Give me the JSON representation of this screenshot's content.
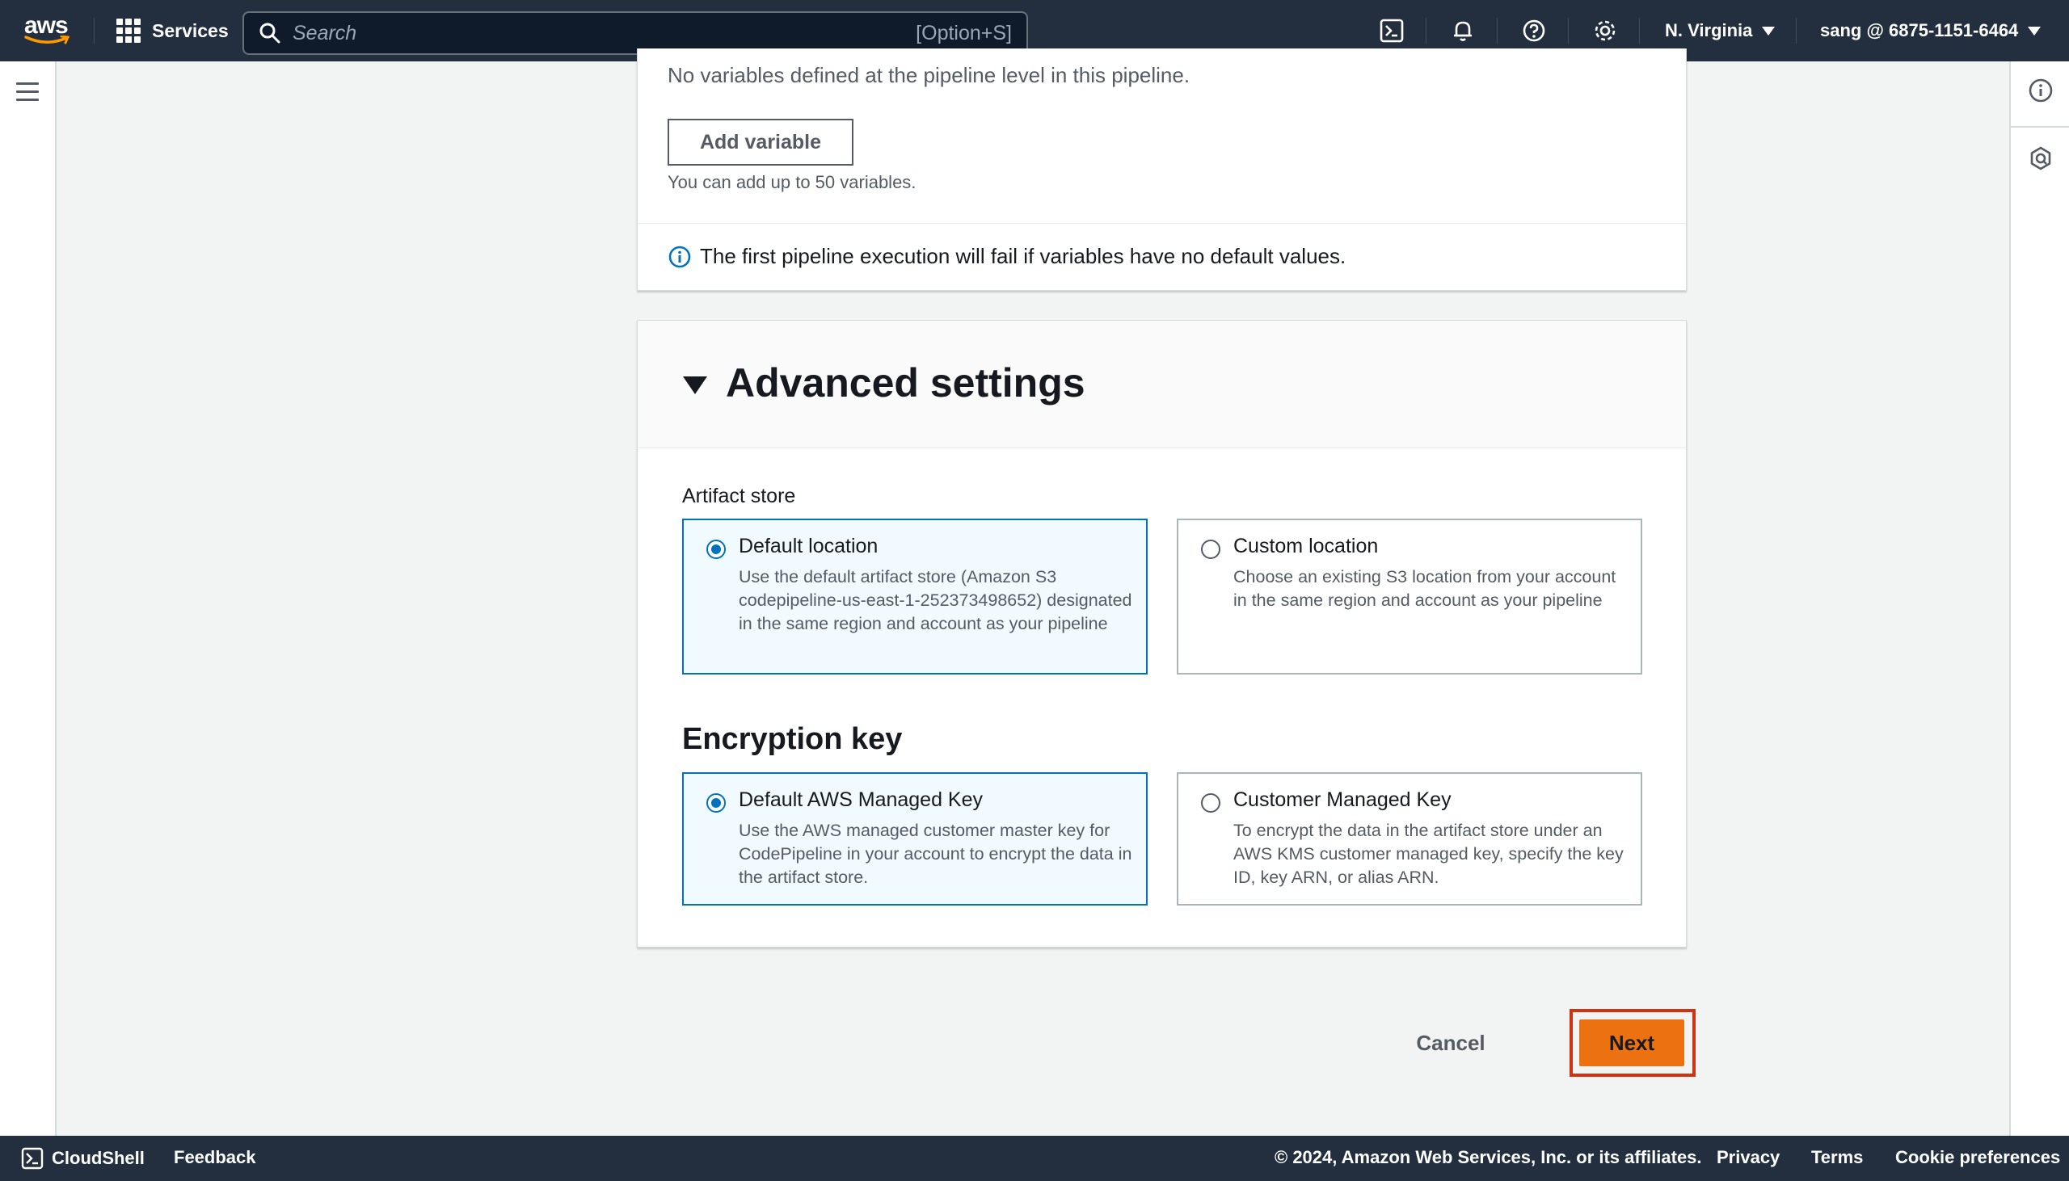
{
  "topnav": {
    "logo_text": "aws",
    "services_label": "Services",
    "search_placeholder": "Search",
    "search_shortcut": "[Option+S]",
    "region": "N. Virginia",
    "account": "sang @ 6875-1151-6464"
  },
  "variables_panel": {
    "empty_text": "No variables defined at the pipeline level in this pipeline.",
    "add_button": "Add variable",
    "limit_hint": "You can add up to 50 variables.",
    "info_text": "The first pipeline execution will fail if variables have no default values."
  },
  "advanced": {
    "title": "Advanced settings",
    "artifact_store_label": "Artifact store",
    "artifact_options": [
      {
        "title": "Default location",
        "description": "Use the default artifact store (Amazon S3 codepipeline-us-east-1-252373498652) designated in the same region and account as your pipeline",
        "selected": true
      },
      {
        "title": "Custom location",
        "description": "Choose an existing S3 location from your account in the same region and account as your pipeline",
        "selected": false
      }
    ],
    "encryption_title": "Encryption key",
    "encryption_options": [
      {
        "title": "Default AWS Managed Key",
        "description": "Use the AWS managed customer master key for CodePipeline in your account to encrypt the data in the artifact store.",
        "selected": true
      },
      {
        "title": "Customer Managed Key",
        "description": "To encrypt the data in the artifact store under an AWS KMS customer managed key, specify the key ID, key ARN, or alias ARN.",
        "selected": false
      }
    ]
  },
  "actions": {
    "cancel": "Cancel",
    "next": "Next"
  },
  "footer": {
    "cloudshell": "CloudShell",
    "feedback": "Feedback",
    "copyright": "© 2024, Amazon Web Services, Inc. or its affiliates.",
    "privacy": "Privacy",
    "terms": "Terms",
    "cookies": "Cookie preferences"
  },
  "colors": {
    "nav_bg": "#232f3e",
    "primary": "#ec7211",
    "selected_border": "#0073bb",
    "selected_bg": "#f1faff",
    "highlight": "#d13212",
    "page_bg": "#f2f3f3"
  },
  "icons": [
    "grid-icon",
    "search-icon",
    "cloudshell-icon",
    "bell-icon",
    "help-icon",
    "settings-icon",
    "menu-icon",
    "info-icon",
    "hexagon-icon",
    "info-circle-icon",
    "caret-down-icon"
  ]
}
